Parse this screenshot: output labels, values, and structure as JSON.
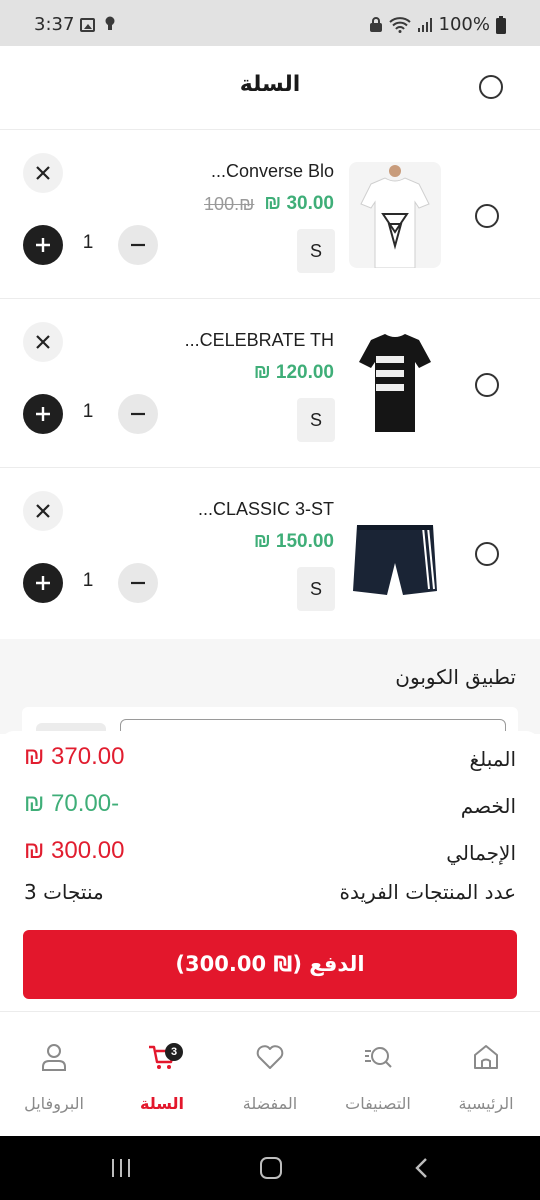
{
  "status_bar": {
    "time": "3:37",
    "battery": "100%"
  },
  "header": {
    "title": "السلة"
  },
  "items": [
    {
      "name": "...Converse Blo",
      "price": "₪ 30.00",
      "old_price": "100.₪",
      "size": "S",
      "qty": "1"
    },
    {
      "name": "...CELEBRATE TH",
      "price": "₪ 120.00",
      "old_price": "",
      "size": "S",
      "qty": "1"
    },
    {
      "name": "...CLASSIC 3-ST",
      "price": "₪ 150.00",
      "old_price": "",
      "size": "S",
      "qty": "1"
    }
  ],
  "coupon": {
    "title": "تطبيق الكوبون"
  },
  "summary": {
    "amount_label": "المبلغ",
    "amount_value": "₪ 370.00",
    "discount_label": "الخصم",
    "discount_value": "₪ 70.00-",
    "total_label": "الإجمالي",
    "total_value": "₪ 300.00",
    "unique_label": "عدد المنتجات الفريدة",
    "unique_value": "3 منتجات"
  },
  "pay_button": {
    "label": "الدفع (₪ 300.00)"
  },
  "bottom_nav": {
    "items": [
      {
        "label": "الرئيسية",
        "icon": "home-icon"
      },
      {
        "label": "التصنيفات",
        "icon": "categories-icon"
      },
      {
        "label": "المفضلة",
        "icon": "heart-icon"
      },
      {
        "label": "السلة",
        "icon": "cart-icon",
        "badge": "3",
        "active": true
      },
      {
        "label": "البروفايل",
        "icon": "profile-icon"
      }
    ]
  },
  "colors": {
    "accent": "#e3172c",
    "price_green": "#3fae78",
    "price_red": "#e11d2f"
  }
}
